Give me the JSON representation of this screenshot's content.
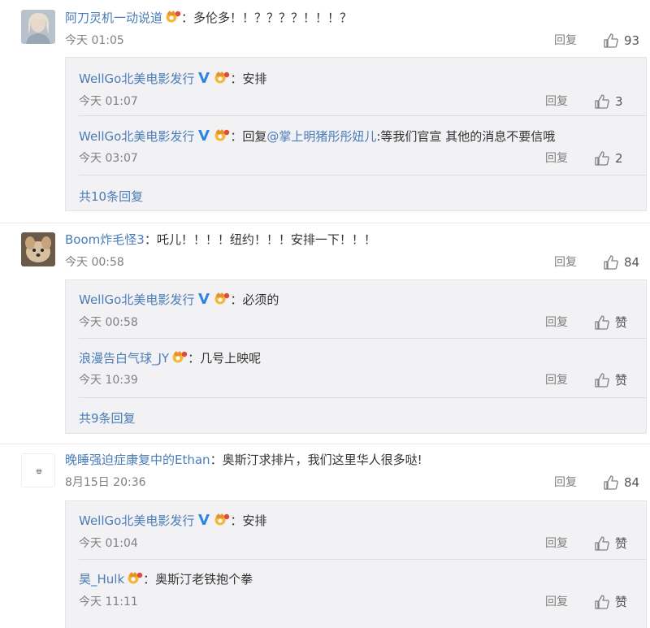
{
  "colors": {
    "link": "#4a7cb8",
    "text": "#333333",
    "meta": "#808080",
    "reply_bg": "#f2f2f5"
  },
  "comments": [
    {
      "user": "阿刀灵机一动说道",
      "text": "多伦多！！？？？？！！！？",
      "time": "今天 01:05",
      "reply_label": "回复",
      "likes": "93",
      "replies": [
        {
          "user": "WellGo北美电影发行",
          "text": "安排",
          "time": "今天 01:07",
          "reply_label": "回复",
          "likes": "3"
        },
        {
          "user": "WellGo北美电影发行",
          "prefix": "回复",
          "mention": "@掌上明猪彤彤妞儿",
          "text": ":等我们官宣 其他的消息不要信哦",
          "time": "今天 03:07",
          "reply_label": "回复",
          "likes": "2"
        }
      ],
      "more": "共10条回复"
    },
    {
      "user": "Boom炸毛怪3",
      "text": "吒儿！！！！纽约！！！安排一下！！！",
      "time": "今天 00:58",
      "reply_label": "回复",
      "likes": "84",
      "replies": [
        {
          "user": "WellGo北美电影发行",
          "text": "必须的",
          "time": "今天 00:58",
          "reply_label": "回复",
          "likes": "赞"
        },
        {
          "user": "浪漫告白气球_JY",
          "text": "几号上映呢",
          "time": "今天 10:39",
          "reply_label": "回复",
          "likes": "赞"
        }
      ],
      "more": "共9条回复"
    },
    {
      "user": "晚睡强迫症康复中的Ethan",
      "text": "奥斯汀求排片，我们这里华人很多哒!",
      "time": "8月15日 20:36",
      "reply_label": "回复",
      "likes": "84",
      "replies": [
        {
          "user": "WellGo北美电影发行",
          "text": "安排",
          "time": "今天 01:04",
          "reply_label": "回复",
          "likes": "赞"
        },
        {
          "user": "昊_Hulk",
          "text": "奥斯汀老铁抱个拳",
          "time": "今天 11:11",
          "reply_label": "回复",
          "likes": "赞"
        }
      ]
    }
  ]
}
